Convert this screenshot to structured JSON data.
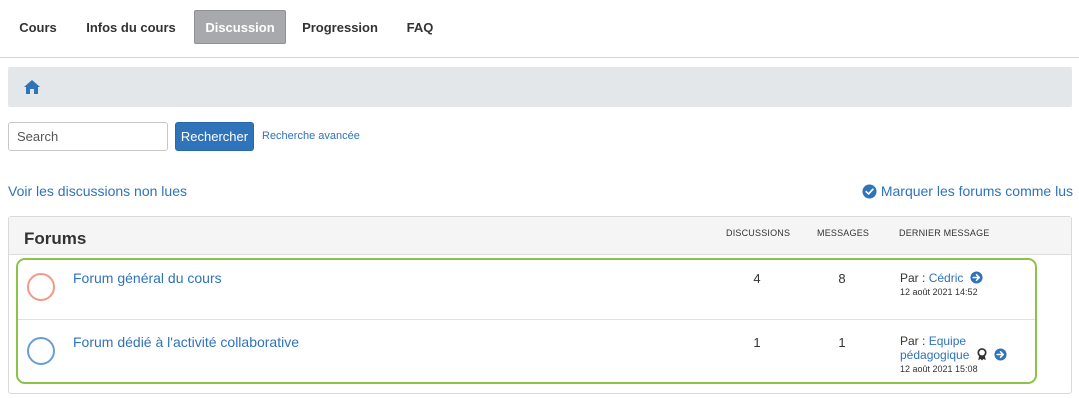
{
  "nav": {
    "tabs": [
      {
        "label": "Cours",
        "active": false
      },
      {
        "label": "Infos du cours",
        "active": false
      },
      {
        "label": "Discussion",
        "active": true
      },
      {
        "label": "Progression",
        "active": false
      },
      {
        "label": "FAQ",
        "active": false
      }
    ]
  },
  "breadcrumb": {
    "icon": "home-icon"
  },
  "search": {
    "placeholder": "Search",
    "button_label": "Rechercher",
    "advanced_link": "Recherche avancée"
  },
  "links": {
    "unread": "Voir les discussions non lues",
    "mark_read": "Marquer les forums comme lus"
  },
  "forums": {
    "title": "Forums",
    "columns": {
      "discussions": "DISCUSSIONS",
      "messages": "MESSAGES",
      "last_message": "DERNIER MESSAGE"
    },
    "rows": [
      {
        "name": "Forum général du cours",
        "discussions": "4",
        "messages": "8",
        "by_label": "Par :",
        "author": "Cédric",
        "date": "12 août 2021 14:52",
        "circle_color": "#f2998a"
      },
      {
        "name": "Forum dédié à l'activité collaborative",
        "discussions": "1",
        "messages": "1",
        "by_label": "Par :",
        "author_line1": "Equipe",
        "author_line2": "pédagogique",
        "date": "12 août 2021 15:08",
        "circle_color": "#6a9fd4"
      }
    ]
  },
  "colors": {
    "accent_blue": "#2f73ba",
    "active_tab": "#a7a9ac",
    "highlight_green": "#8bc34a"
  }
}
